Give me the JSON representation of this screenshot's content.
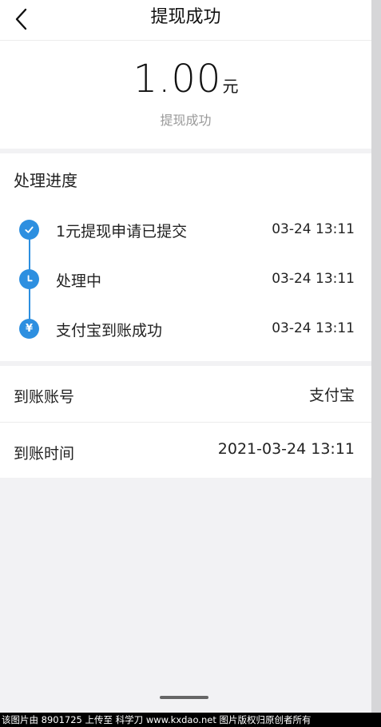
{
  "header": {
    "title": "提现成功"
  },
  "summary": {
    "amount": "1.00",
    "unit": "元",
    "status": "提现成功"
  },
  "progress": {
    "title": "处理进度",
    "steps": [
      {
        "label": "1元提现申请已提交",
        "time": "03-24 13:11",
        "icon": "check-icon"
      },
      {
        "label": "处理中",
        "time": "03-24 13:11",
        "icon": "clock-icon"
      },
      {
        "label": "支付宝到账成功",
        "time": "03-24 13:11",
        "icon": "yen-icon"
      }
    ]
  },
  "details": {
    "rows": [
      {
        "label": "到账账号",
        "value": "支付宝"
      },
      {
        "label": "到账时间",
        "value": "2021-03-24 13:11"
      }
    ]
  },
  "watermark": "该图片由 8901725 上传至 科学刀 www.kxdao.net 图片版权归原创者所有",
  "colors": {
    "accent": "#2d8fe0",
    "background": "#f2f2f4"
  }
}
